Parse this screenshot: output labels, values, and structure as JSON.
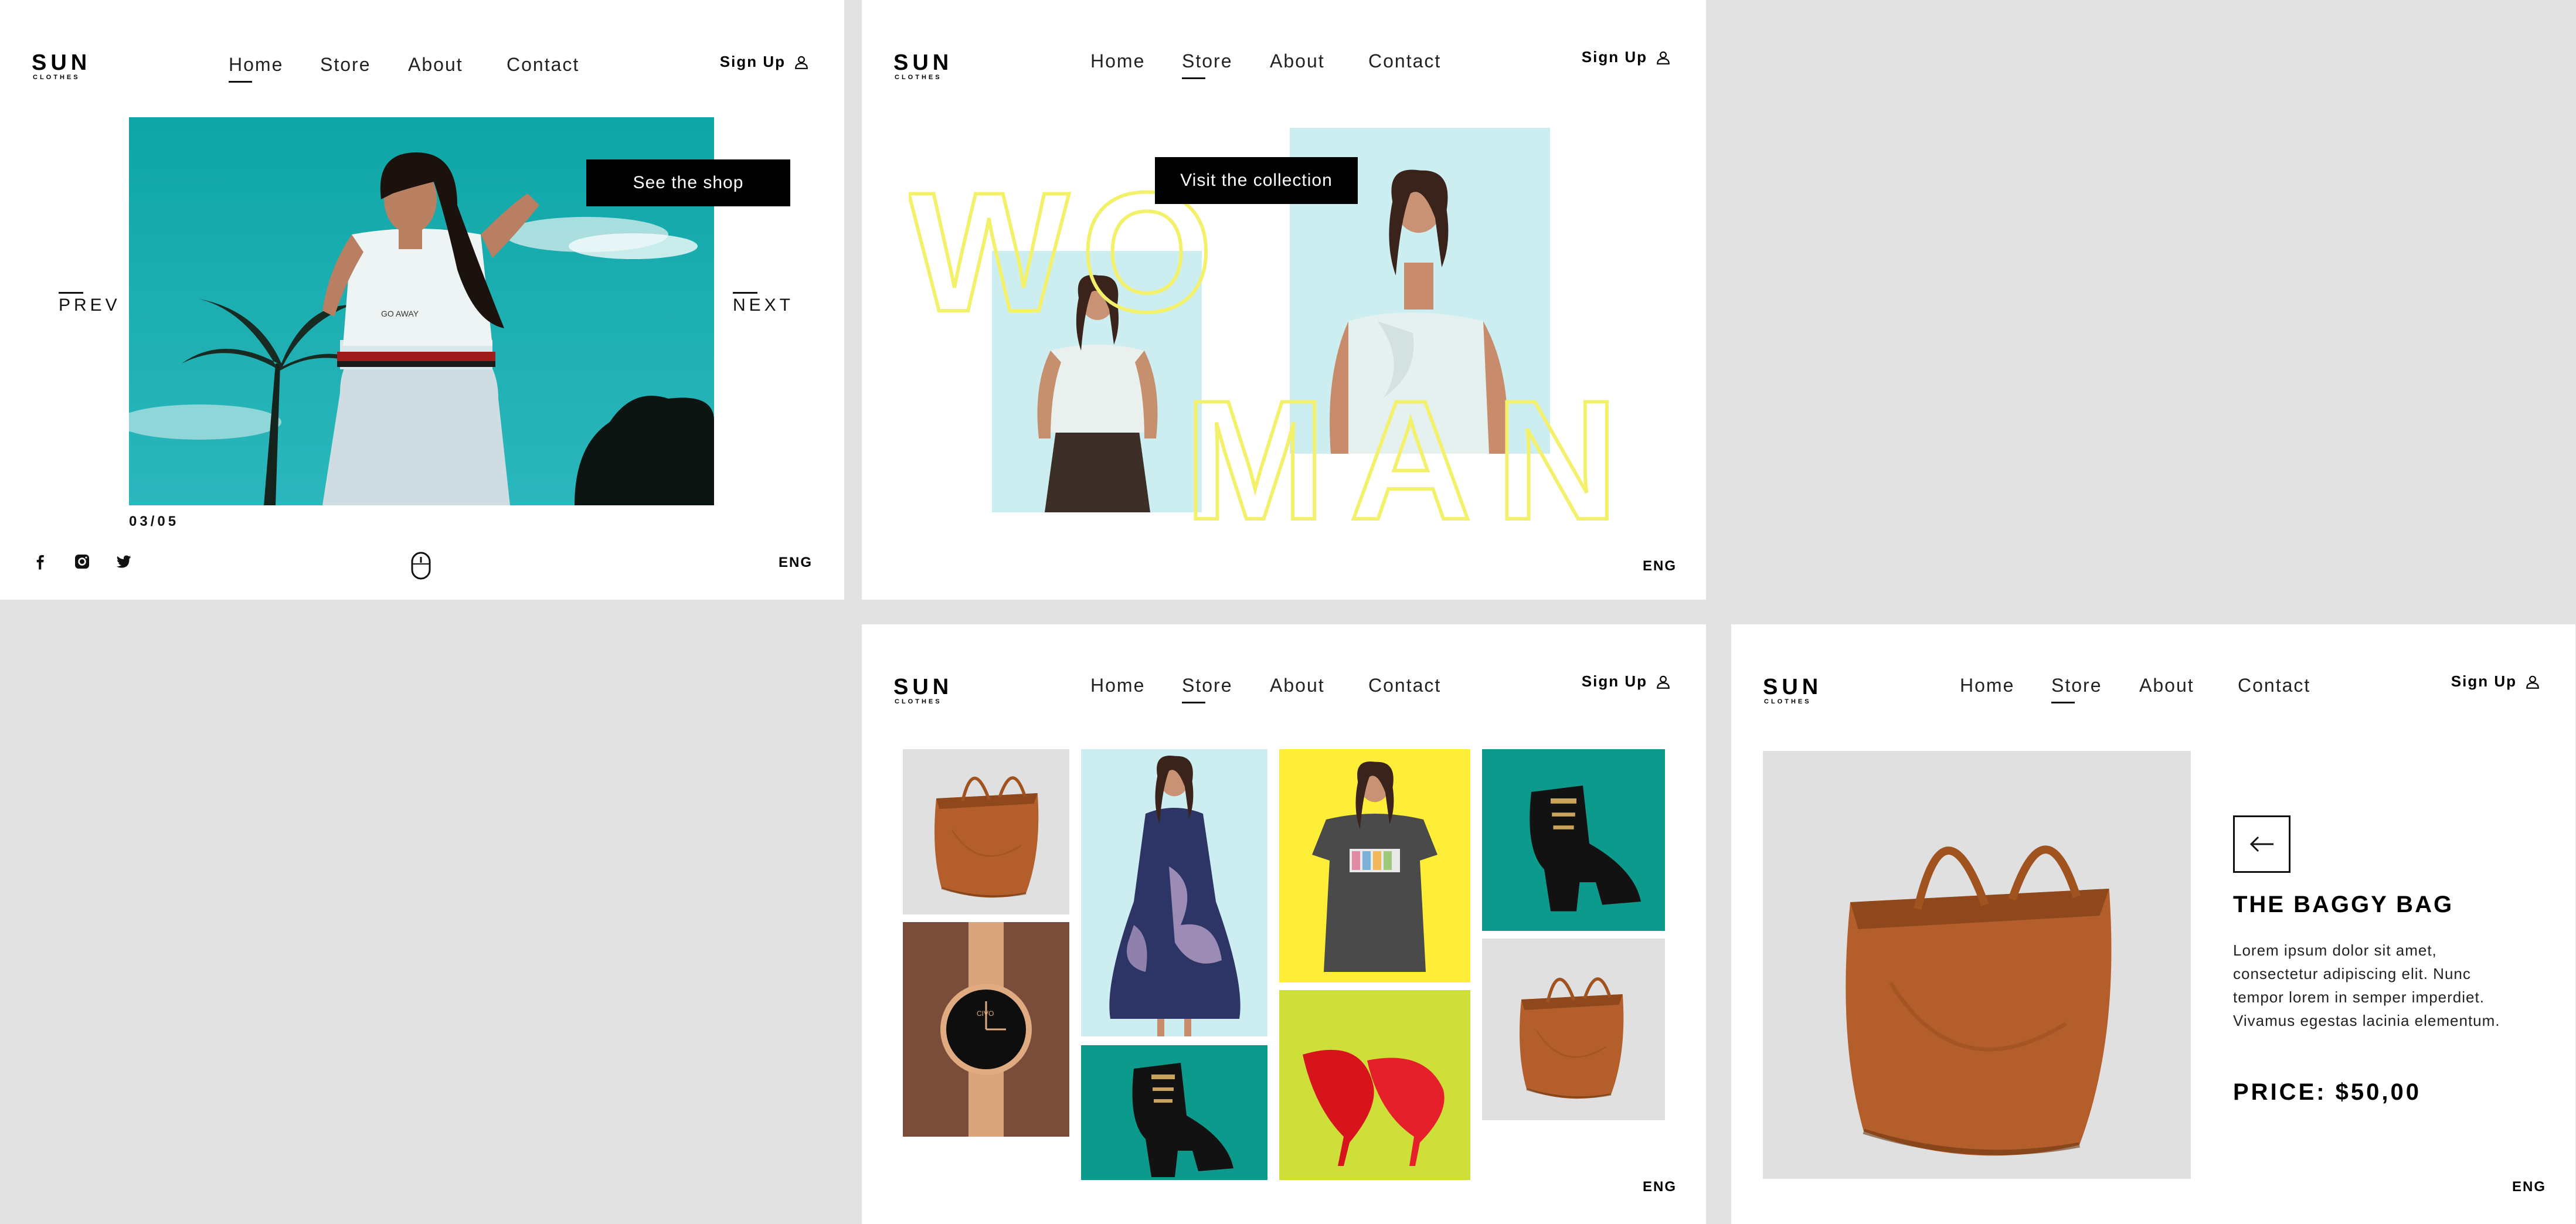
{
  "brand": {
    "name": "SUN",
    "tagline": "CLOTHES"
  },
  "nav": {
    "home": "Home",
    "store": "Store",
    "about": "About",
    "contact": "Contact"
  },
  "signup": "Sign Up",
  "lang": "ENG",
  "icons": {
    "user": "user-icon",
    "facebook": "facebook-icon",
    "instagram": "instagram-icon",
    "twitter": "twitter-icon",
    "mouse": "mouse-scroll-icon",
    "back": "arrow-left-icon"
  },
  "slide1": {
    "cta": "See the shop",
    "prev": "PREV",
    "next": "NEXT",
    "counter": "03/05",
    "shirt_print": "GO AWAY"
  },
  "slide2": {
    "cta": "Visit the collection",
    "word_top": "WO",
    "word_bottom": "MAN"
  },
  "product": {
    "title": "THE BAGGY BAG",
    "description": "Lorem ipsum dolor sit amet, consectetur adipiscing elit. Nunc tempor lorem in semper imperdiet. Vivamus egestas lacinia elementum.",
    "price": "PRICE: $50,00"
  },
  "watch_brand": "CIVO",
  "colors": {
    "teal": "#0b9a8c",
    "sky": "#cdeef1",
    "yellow": "#ffee38",
    "lime": "#cfdf3a",
    "brown": "#7a4d3b",
    "grey": "#e0e0e0",
    "outline_yellow": "#f3f06a",
    "leather": "#b5622c"
  }
}
